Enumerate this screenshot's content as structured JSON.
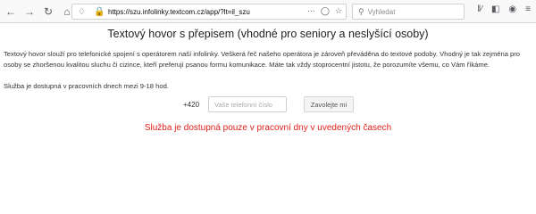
{
  "browser": {
    "url": "https://szu.infolinky.textcom.cz/app/?lt=il_szu",
    "search_placeholder": "Vyhledat",
    "icons": {
      "back": "back-arrow-icon",
      "forward": "forward-arrow-icon",
      "reload": "reload-icon",
      "home": "home-icon",
      "shield": "shield-icon",
      "lock": "lock-icon",
      "more": "more-dots-icon",
      "pocket": "pocket-icon",
      "bookmark": "star-icon",
      "search": "search-icon",
      "library": "library-icon",
      "sidebar": "sidebar-icon",
      "account": "account-icon",
      "menu": "hamburger-menu-icon"
    }
  },
  "page": {
    "title": "Textový hovor s přepisem (vhodné pro seniory a neslyšící osoby)",
    "description": "Textový hovor slouží pro telefonické spojení s operátorem naší infolinky. Veškerá řeč našeho operátora je zároveň převáděna do textové podoby. Vhodný je tak zejména pro osoby se zhoršenou kvalitou sluchu či cizince, kteří preferují psanou formu komunikace. Máte tak vždy stoprocentní jistotu, že porozumíte všemu, co Vám říkáme.",
    "availability": "Služba je dostupná v pracovních dnech mezi 9-18 hod.",
    "phone_prefix": "+420",
    "phone_placeholder": "Vaše telefonní číslo",
    "phone_value": "",
    "call_button": "Zavolejte mi",
    "notice": "Služba je dostupná pouze v pracovní dny v uvedených časech",
    "notice_color": "#e0201a"
  }
}
